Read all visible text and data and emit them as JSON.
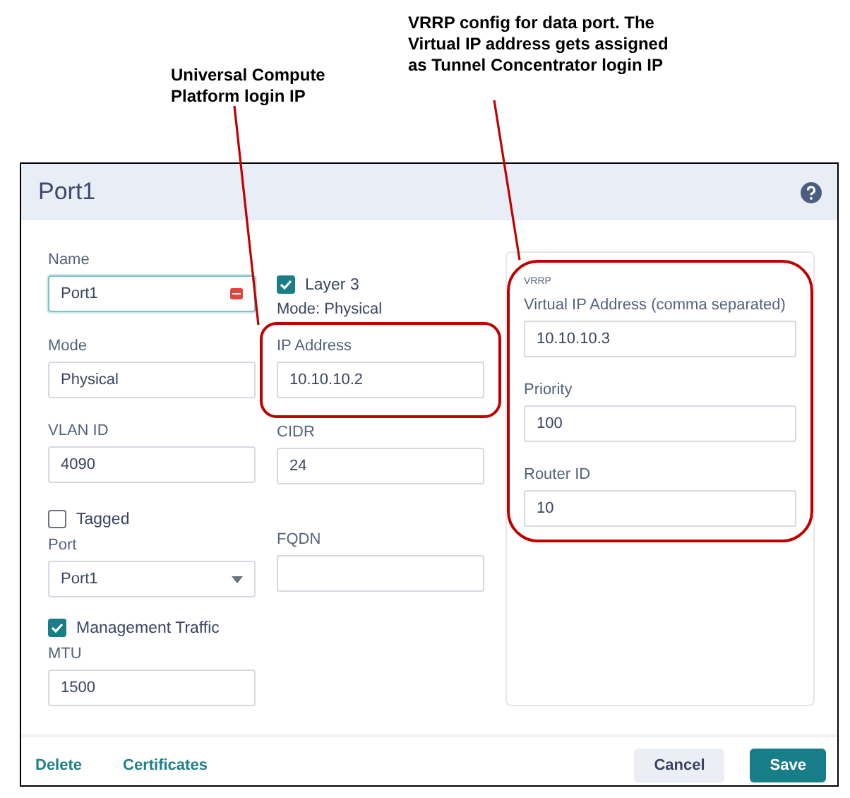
{
  "annotations": [
    {
      "text": "Universal Compute Platform login IP"
    },
    {
      "text": "VRRP config for data port. The Virtual IP address gets assigned as Tunnel Concentrator login IP"
    }
  ],
  "dialog": {
    "title": "Port1"
  },
  "left_column": [
    {
      "kind": "field",
      "label": "Name",
      "value": "Port1",
      "focused": true,
      "has_icon": true
    },
    {
      "kind": "field",
      "label": "Mode",
      "value": "Physical"
    },
    {
      "kind": "field",
      "label": "VLAN ID",
      "value": "4090"
    },
    {
      "kind": "checkbox",
      "label": "Tagged",
      "checked": false
    },
    {
      "kind": "select",
      "label": "Port",
      "value": "Port1"
    },
    {
      "kind": "checkbox",
      "label": "Management Traffic",
      "checked": true
    },
    {
      "kind": "field",
      "label": "MTU",
      "value": "1500"
    }
  ],
  "middle_column": [
    {
      "kind": "checkbox",
      "label": "Layer 3",
      "checked": true
    },
    {
      "kind": "note",
      "text": "Mode: Physical"
    },
    {
      "kind": "field",
      "label": "IP Address",
      "value": "10.10.10.2",
      "highlighted": true
    },
    {
      "kind": "field",
      "label": "CIDR",
      "value": "24"
    },
    {
      "kind": "field",
      "label": "FQDN"
    }
  ],
  "vrrp": {
    "title": "VRRP",
    "highlighted": true,
    "fields": [
      {
        "kind": "field",
        "label": "Virtual IP Address (comma separated)",
        "value": "10.10.10.3"
      },
      {
        "kind": "field",
        "label": "Priority",
        "value": "100"
      },
      {
        "kind": "field",
        "label": "Router ID",
        "value": "10"
      }
    ]
  },
  "footer": {
    "links": [
      "Delete",
      "Certificates"
    ],
    "buttons": [
      {
        "label": "Cancel",
        "kind": "secondary"
      },
      {
        "label": "Save",
        "kind": "primary"
      }
    ]
  }
}
